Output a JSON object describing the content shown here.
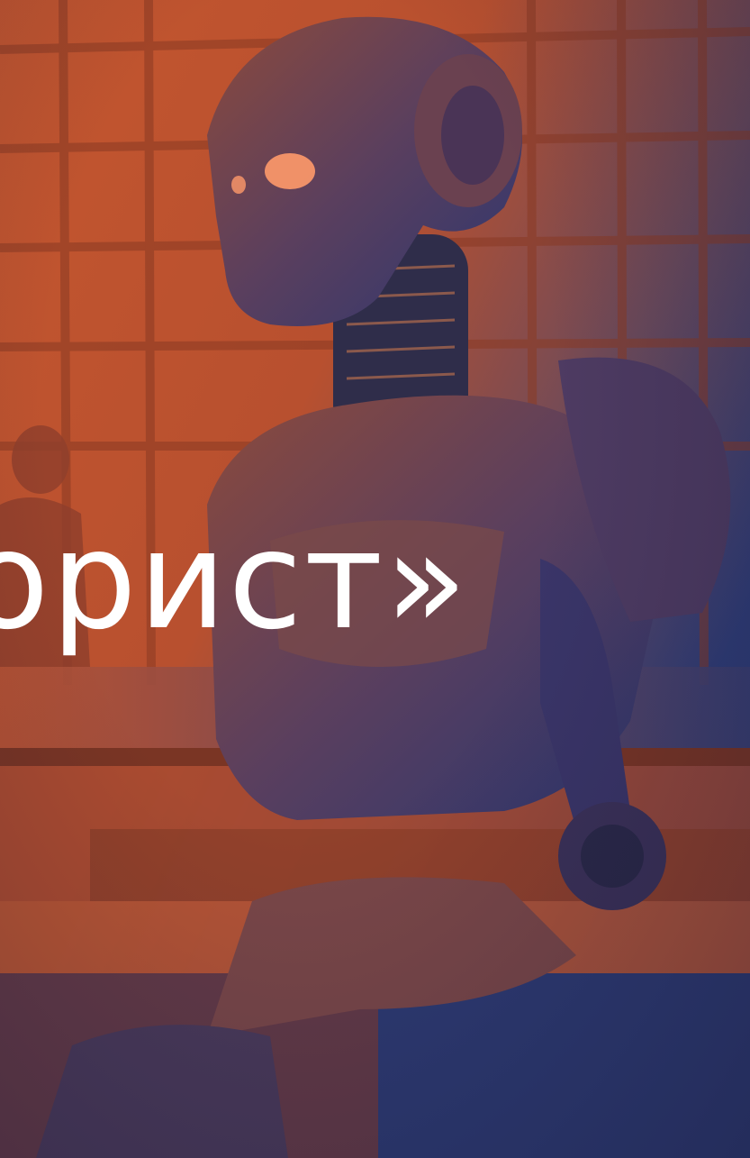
{
  "image": {
    "caption_text": "орист»",
    "colors": {
      "warm_tone": "#c4562f",
      "cool_tone": "#2f3d78",
      "text": "#ffffff"
    }
  }
}
